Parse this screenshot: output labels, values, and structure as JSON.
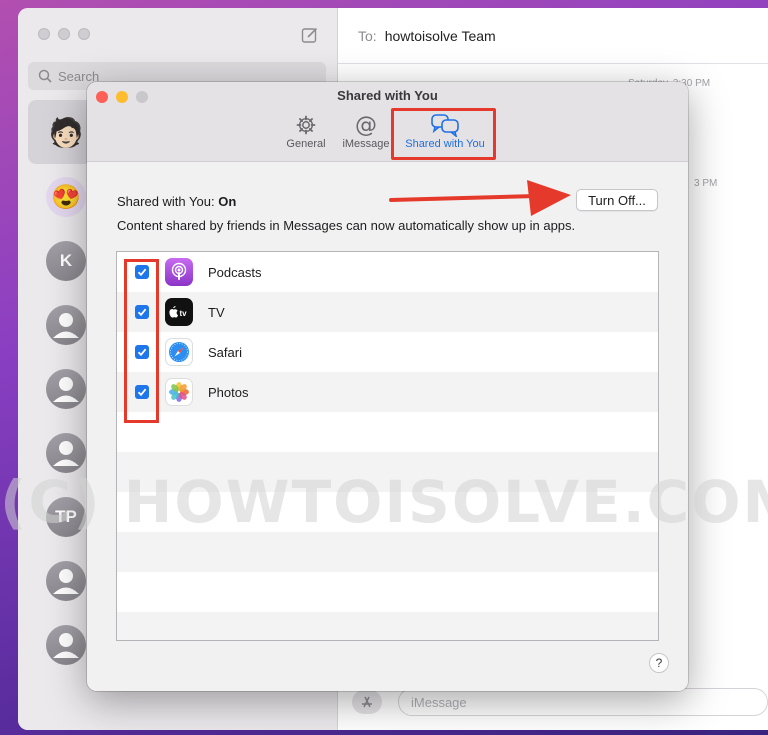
{
  "sidebar": {
    "search_placeholder": "Search",
    "avatars": [
      {
        "kind": "memoji",
        "glyph": "🧑🏻"
      },
      {
        "kind": "emoji",
        "glyph": "😍"
      },
      {
        "kind": "initials",
        "text": "K"
      },
      {
        "kind": "person"
      },
      {
        "kind": "person"
      },
      {
        "kind": "person"
      },
      {
        "kind": "initials",
        "text": "TP"
      },
      {
        "kind": "person"
      },
      {
        "kind": "person"
      }
    ]
  },
  "conversation": {
    "to_label": "To:",
    "recipient": "howtoisolve Team",
    "timestamps": [
      "Saturday, 3:30 PM",
      "3 PM"
    ],
    "input_placeholder": "iMessage"
  },
  "dialog": {
    "title": "Shared with You",
    "tabs": [
      {
        "label": "General",
        "icon": "gear-icon"
      },
      {
        "label": "iMessage",
        "icon": "at-icon"
      },
      {
        "label": "Shared with You",
        "icon": "shared-bubbles-icon",
        "active": true
      }
    ],
    "status_label": "Shared with You:",
    "status_value": "On",
    "turn_off_label": "Turn Off...",
    "description": "Content shared by friends in Messages can now automatically show up in apps.",
    "apps": [
      {
        "name": "Podcasts",
        "checked": true,
        "icon": "podcasts-icon"
      },
      {
        "name": "TV",
        "checked": true,
        "icon": "apple-tv-icon"
      },
      {
        "name": "Safari",
        "checked": true,
        "icon": "safari-icon"
      },
      {
        "name": "Photos",
        "checked": true,
        "icon": "photos-icon"
      }
    ],
    "help_label": "?"
  },
  "watermark": "(C) HOWTOISOLVE.COM",
  "colors": {
    "accent": "#1e6fe6",
    "annotation_red": "#e53a2b",
    "close": "#fe5f57",
    "minimize": "#febc2e",
    "zoom_disabled": "#c9c7cb"
  }
}
